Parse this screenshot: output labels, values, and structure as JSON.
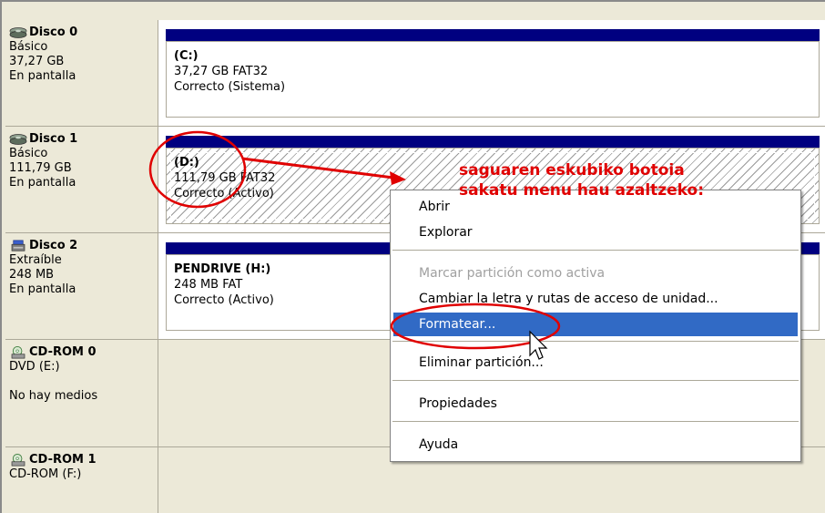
{
  "disks": [
    {
      "name": "Disco 0",
      "type": "Básico",
      "size": "37,27 GB",
      "status": "En pantalla",
      "icon": "hard-disk-icon",
      "volume": {
        "label": "(C:)",
        "info": "37,27 GB FAT32",
        "state": "Correcto (Sistema)"
      }
    },
    {
      "name": "Disco 1",
      "type": "Básico",
      "size": "111,79 GB",
      "status": "En pantalla",
      "icon": "hard-disk-icon",
      "volume": {
        "label": "(D:)",
        "info": "111,79 GB FAT32",
        "state": "Correcto (Activo)"
      }
    },
    {
      "name": "Disco 2",
      "type": "Extraíble",
      "size": "248 MB",
      "status": "En pantalla",
      "icon": "removable-disk-icon",
      "volume": {
        "label": "PENDRIVE  (H:)",
        "info": "248 MB FAT",
        "state": "Correcto (Activo)"
      }
    },
    {
      "name": "CD-ROM 0",
      "type": "DVD (E:)",
      "size": "",
      "status": "No hay medios",
      "icon": "cdrom-icon"
    },
    {
      "name": "CD-ROM 1",
      "type": "CD-ROM (F:)",
      "size": "",
      "status": "",
      "icon": "cdrom-icon"
    }
  ],
  "context_menu": {
    "items": [
      {
        "label": "Abrir",
        "state": "normal"
      },
      {
        "label": "Explorar",
        "state": "normal"
      },
      {
        "label": "Marcar partición como activa",
        "state": "disabled"
      },
      {
        "label": "Cambiar la letra y rutas de acceso de unidad...",
        "state": "normal"
      },
      {
        "label": "Formatear...",
        "state": "selected"
      },
      {
        "label": "Eliminar partición...",
        "state": "normal"
      },
      {
        "label": "Propiedades",
        "state": "normal"
      },
      {
        "label": "Ayuda",
        "state": "normal"
      }
    ]
  },
  "annotation": {
    "line1": "saguaren eskubiko botoia",
    "line2": "sakatu menu hau azaltzeko:",
    "color": "#e00000"
  },
  "colors": {
    "partition_bar": "#000080",
    "menu_highlight": "#316ac5",
    "window_bg": "#ece9d8"
  }
}
